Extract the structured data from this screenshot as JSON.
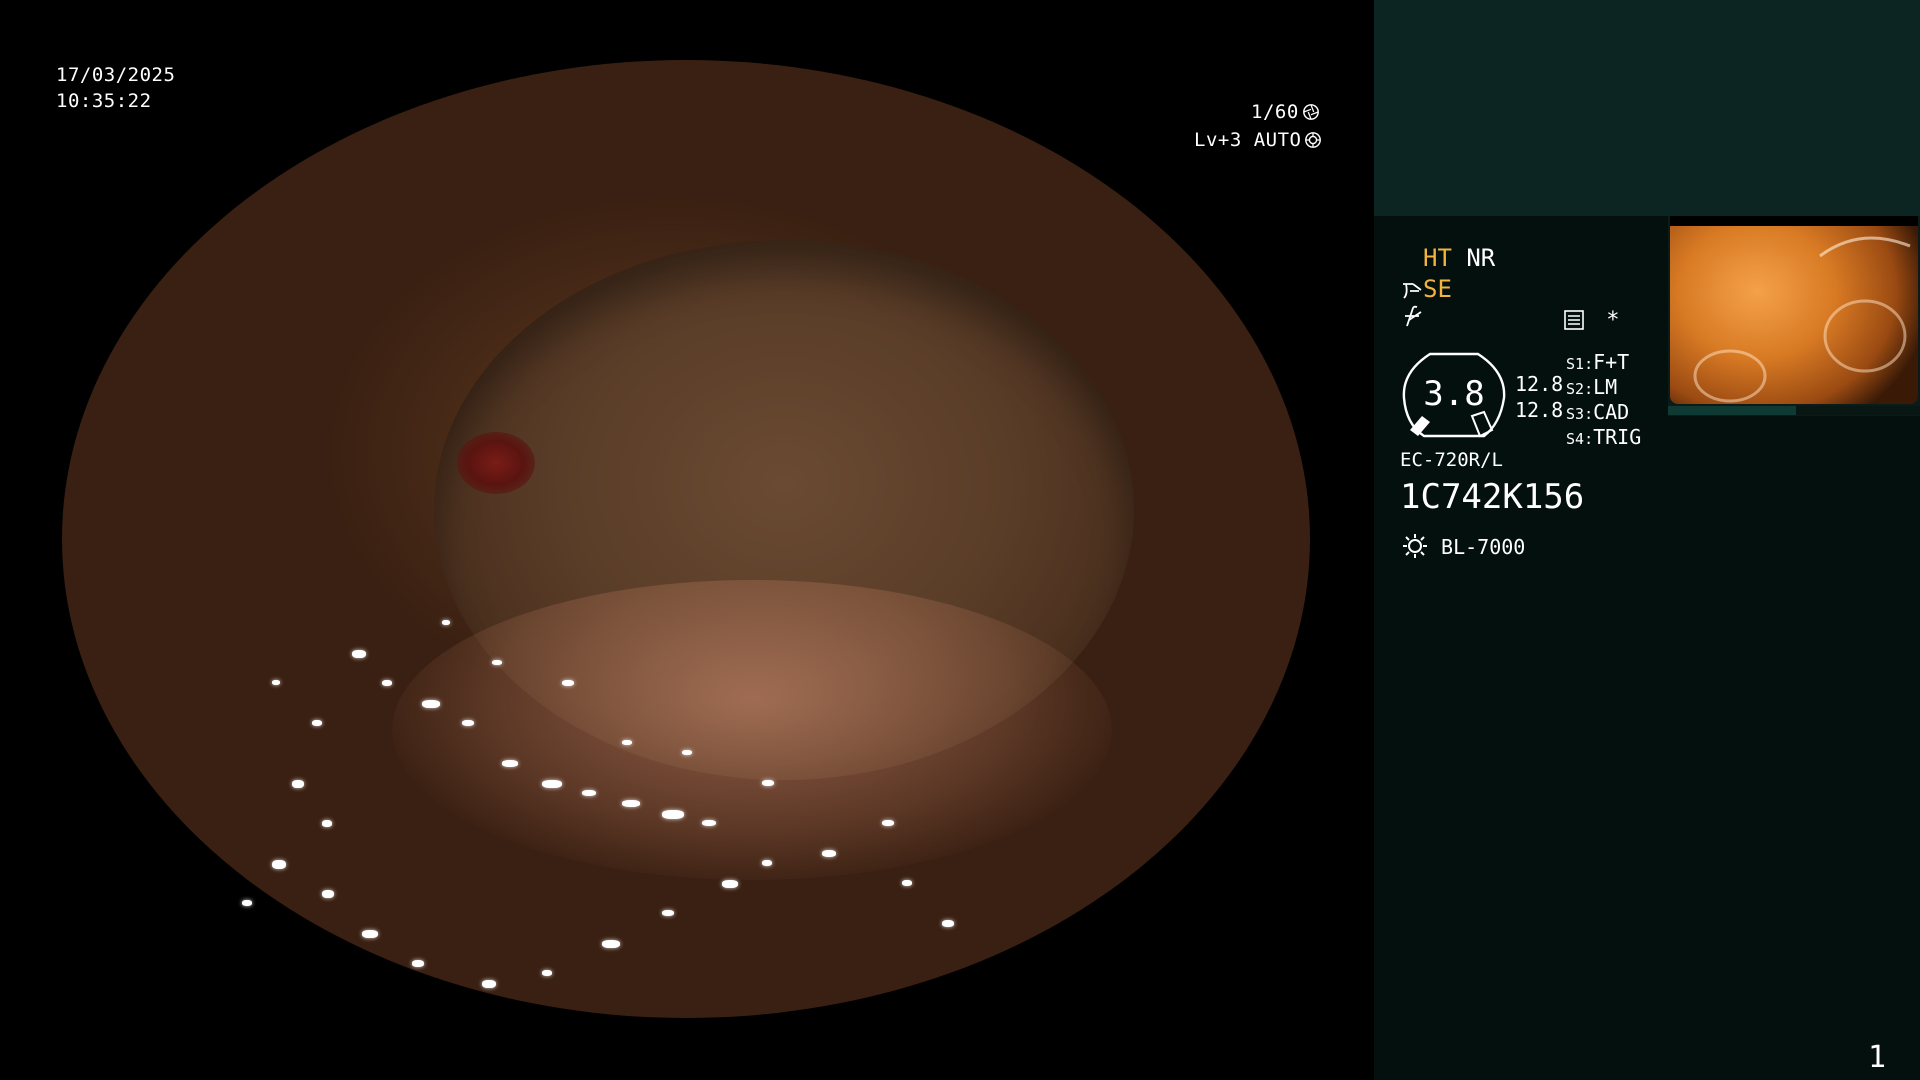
{
  "osd": {
    "date": "17/03/2025",
    "time": "10:35:22",
    "shutter": "1/60",
    "shutter_icon": "aperture-icon",
    "level": "Lv+3 AUTO",
    "iris_icon": "iris-auto-icon"
  },
  "panel": {
    "ht": "HT",
    "nr": "NR",
    "se": "SE",
    "se_icon": "structure-enhance-icon",
    "f_icon": "freeze-icon",
    "menu_icon": "settings-list-icon",
    "star": "*",
    "gauge_value": "3.8",
    "ratio_1": "12.8",
    "ratio_2": "12.8",
    "switches": [
      {
        "key": "S1",
        "value": "F+T"
      },
      {
        "key": "S2",
        "value": "LM"
      },
      {
        "key": "S3",
        "value": "CAD"
      },
      {
        "key": "S4",
        "value": "TRIG"
      }
    ],
    "scope_model": "EC-720R/L",
    "scope_serial": "1C742K156",
    "light_icon": "light-source-icon",
    "light_source": "BL-7000",
    "page": "1"
  },
  "colors": {
    "panel_bg": "#04100e",
    "panel_header": "#0c2422",
    "accent": "#f2b43c"
  }
}
